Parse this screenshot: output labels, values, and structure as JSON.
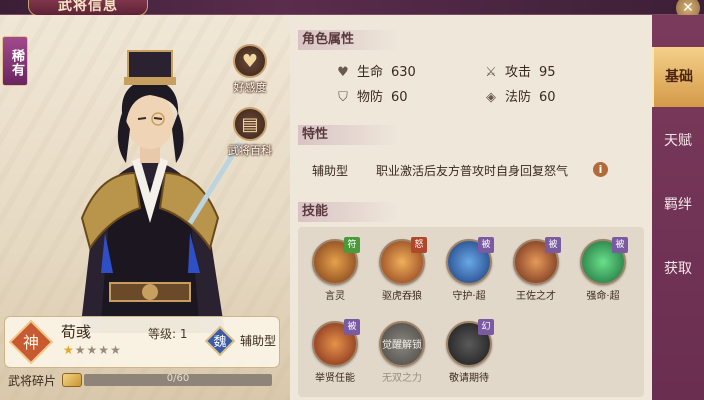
{
  "header": {
    "title": "武将信息",
    "close_icon": "close-icon"
  },
  "hero": {
    "rarity": "稀有",
    "name": "荀彧",
    "god_badge": "神",
    "faction": "魏",
    "level_text": "等级: 1",
    "stars_total": 5,
    "stars_filled": 1,
    "role": "辅助型",
    "shard_label": "武将碎片",
    "shard_progress": "0/60",
    "shard_fraction": 0.0
  },
  "side_buttons": {
    "favor": "好感度",
    "wiki": "武将百科"
  },
  "attributes": {
    "heading": "角色属性",
    "hp_label": "生命",
    "hp_value": "630",
    "atk_label": "攻击",
    "atk_value": "95",
    "pdef_label": "物防",
    "pdef_value": "60",
    "mdef_label": "法防",
    "mdef_value": "60"
  },
  "trait": {
    "heading": "特性",
    "type": "辅助型",
    "description": "职业激活后友方普攻时自身回复怒气"
  },
  "skills": {
    "heading": "技能",
    "items": [
      {
        "name": "言灵",
        "tag": "符",
        "tag_color": "#4a9a3a"
      },
      {
        "name": "驱虎吞狼",
        "tag": "怒",
        "tag_color": "#b0462a"
      },
      {
        "name": "守护·超",
        "tag": "被",
        "tag_color": "#7a5aa0"
      },
      {
        "name": "王佐之才",
        "tag": "被",
        "tag_color": "#7a5aa0"
      },
      {
        "name": "强命·超",
        "tag": "被",
        "tag_color": "#7a5aa0"
      },
      {
        "name": "举贤任能",
        "tag": "被",
        "tag_color": "#7a5aa0"
      },
      {
        "name": "无双之力",
        "tag": "",
        "locked_text": "觉醒解锁"
      },
      {
        "name": "敬请期待",
        "tag": "幻",
        "tag_color": "#7a5aa0"
      }
    ]
  },
  "tabs": [
    "基础",
    "天赋",
    "羁绊",
    "获取"
  ],
  "colors": {
    "accent": "#d49a48",
    "panel": "#efe7da",
    "frame": "#6a2e50"
  }
}
